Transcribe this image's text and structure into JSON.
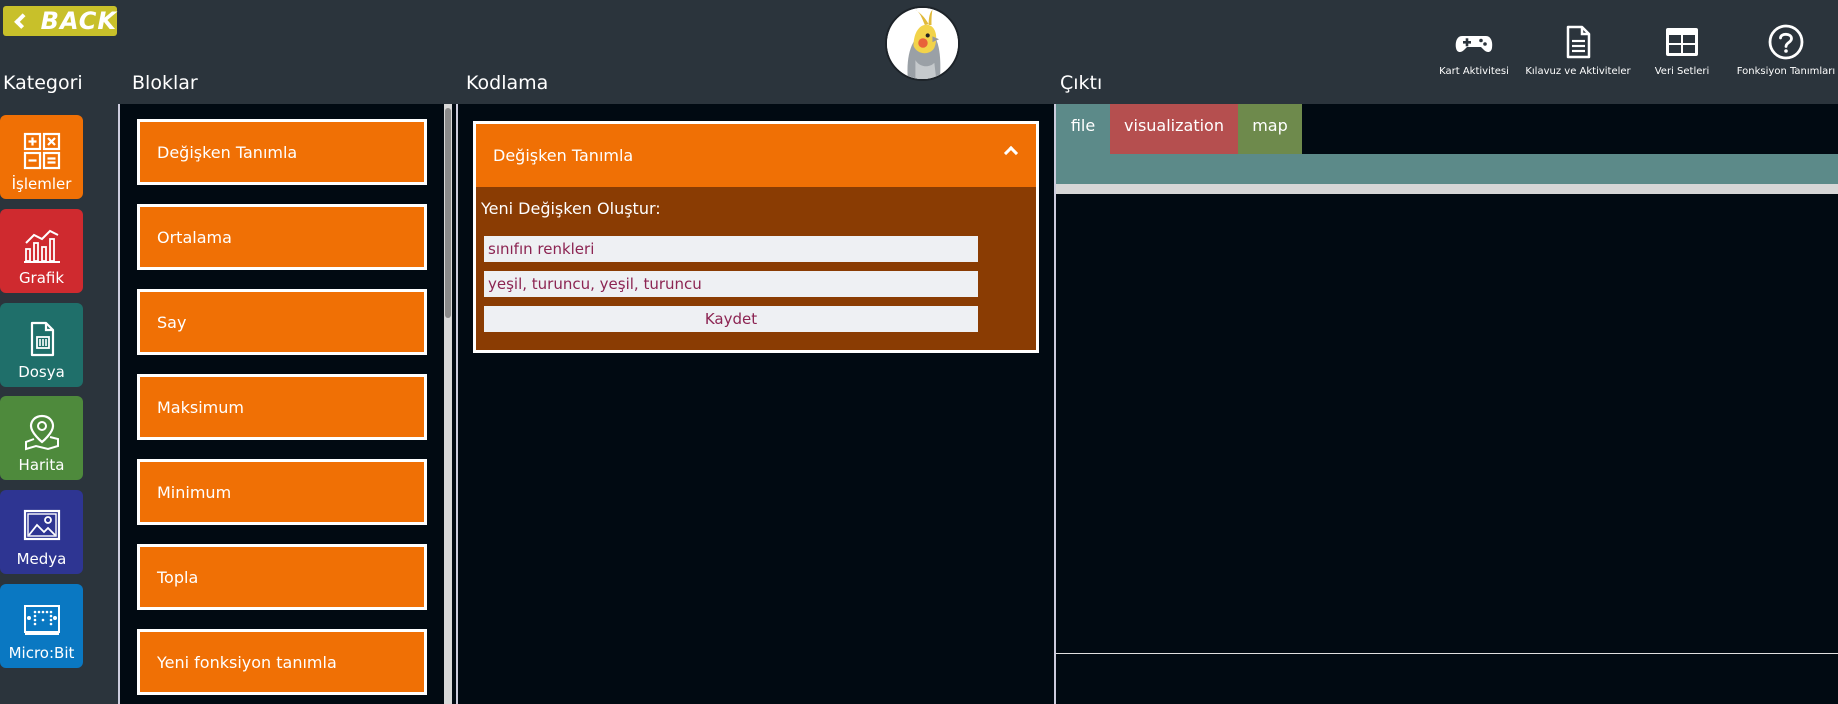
{
  "header": {
    "back_label": "BACK",
    "sections": {
      "kategori": "Kategori",
      "bloklar": "Bloklar",
      "kodlama": "Kodlama",
      "cikti": "Çıktı"
    },
    "top_icons": [
      {
        "label": "Kart Aktivitesi",
        "icon": "gamepad-icon"
      },
      {
        "label": "Kılavuz ve Aktiviteler",
        "icon": "document-icon"
      },
      {
        "label": "Veri Setleri",
        "icon": "table-icon"
      },
      {
        "label": "Fonksiyon Tanımları",
        "icon": "help-circle-icon"
      }
    ]
  },
  "categories": [
    {
      "label": "İşlemler",
      "icon": "calculator-icon",
      "color": "#f07005"
    },
    {
      "label": "Grafik",
      "icon": "chart-icon",
      "color": "#cf2a2f"
    },
    {
      "label": "Dosya",
      "icon": "file-icon",
      "color": "#1f6f6a"
    },
    {
      "label": "Harita",
      "icon": "map-pin-icon",
      "color": "#4e8a3c"
    },
    {
      "label": "Medya",
      "icon": "image-icon",
      "color": "#2e3592"
    },
    {
      "label": "Micro:Bit",
      "icon": "microbit-icon",
      "color": "#0a78c2"
    }
  ],
  "blocks": [
    "Değişken Tanımla",
    "Ortalama",
    "Say",
    "Maksimum",
    "Minimum",
    "Topla",
    "Yeni fonksiyon tanımla"
  ],
  "code_block": {
    "title": "Değişken Tanımla",
    "subtitle": "Yeni Değişken Oluştur:",
    "name_value": "sınıfın renkleri",
    "values_value": " yeşil, turuncu, yeşil, turuncu",
    "save_label": "Kaydet"
  },
  "output": {
    "tabs": [
      {
        "label": "file",
        "color": "#5c8a89"
      },
      {
        "label": "visualization",
        "color": "#b54f4f"
      },
      {
        "label": "map",
        "color": "#6e8a4c"
      }
    ]
  }
}
